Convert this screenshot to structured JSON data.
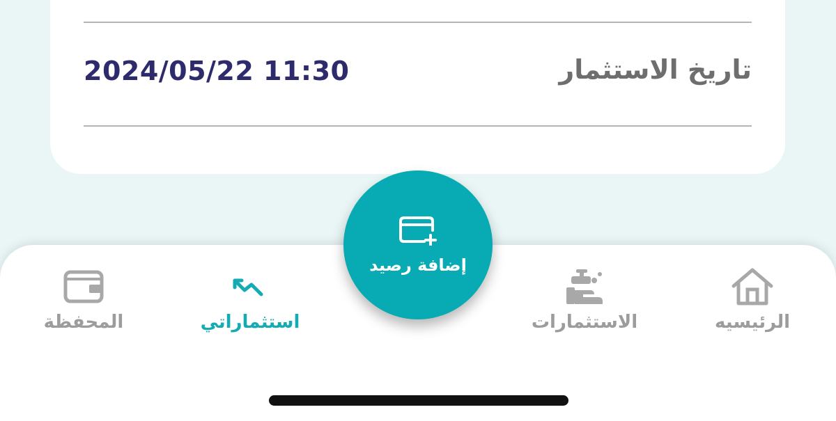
{
  "details": {
    "investment_date_label": "تاريخ الاستثمار",
    "investment_date_value": "2024/05/22 11:30"
  },
  "fab": {
    "label": "إضافة رصيد",
    "icon": "card-plus-icon"
  },
  "nav": {
    "items": [
      {
        "label": "الرئيسيه",
        "icon": "home-icon",
        "active": false
      },
      {
        "label": "الاستثمارات",
        "icon": "investments-icon",
        "active": false
      },
      {
        "label": "استثماراتي",
        "icon": "trend-icon",
        "active": true
      },
      {
        "label": "المحفظة",
        "icon": "wallet-icon",
        "active": false
      }
    ]
  },
  "colors": {
    "accent": "#08aab4",
    "active_text": "#14abb3",
    "inactive": "#9c9c9c",
    "value_text": "#2d2b6b",
    "label_text": "#6e6e6e",
    "background": "#eaf6f6"
  }
}
